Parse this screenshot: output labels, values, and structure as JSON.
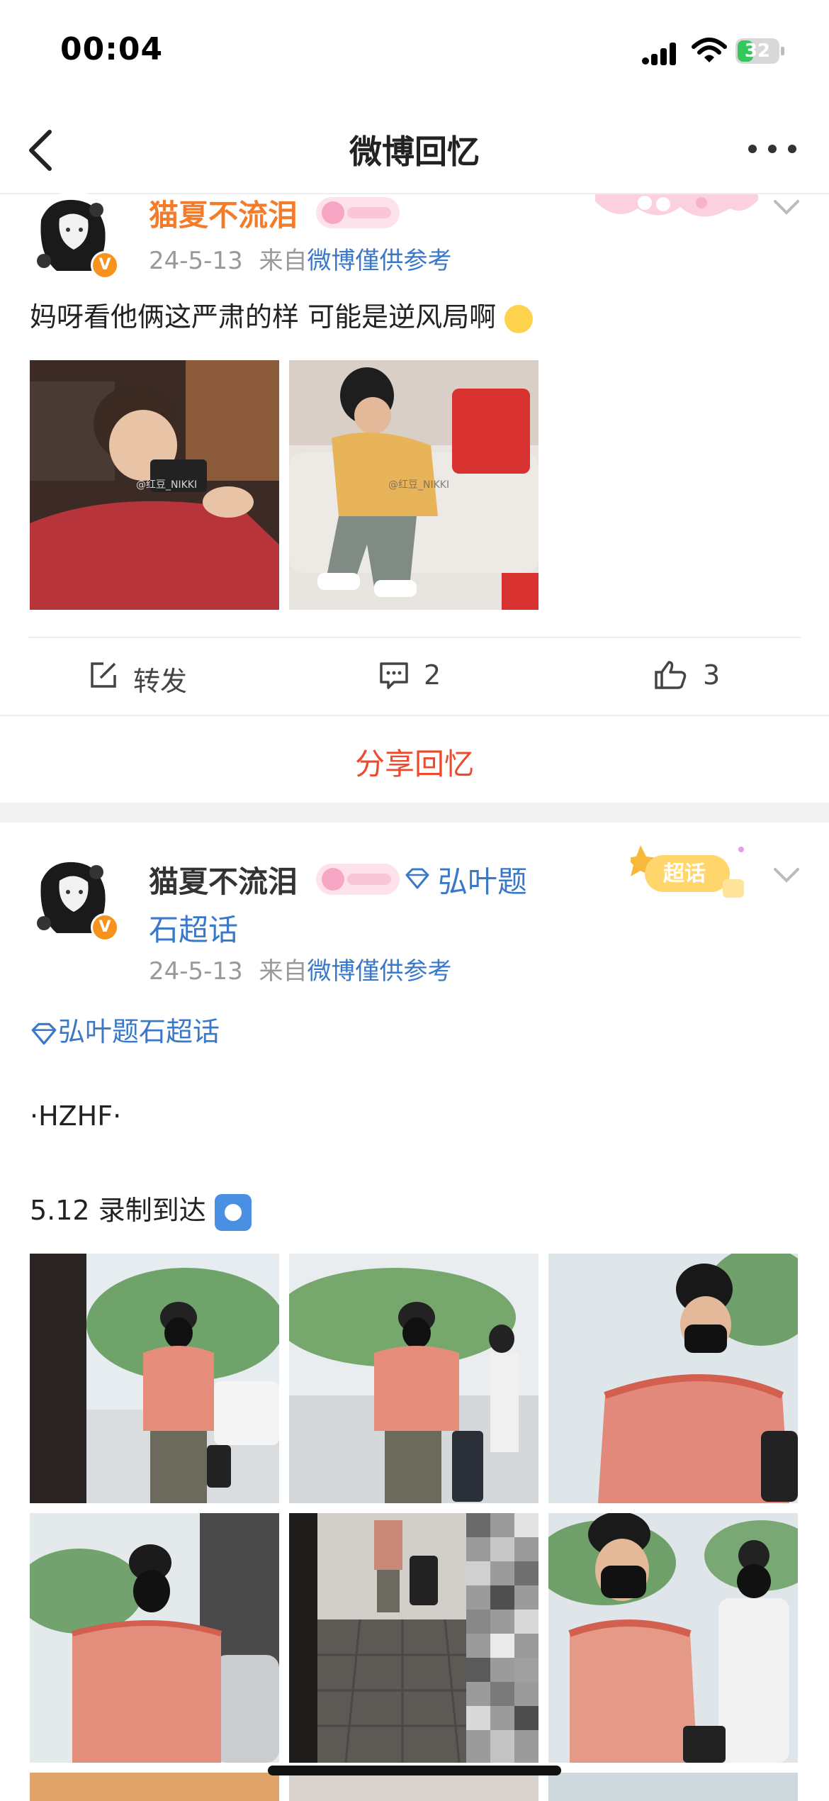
{
  "status": {
    "time": "00:04",
    "battery": "32"
  },
  "nav": {
    "title": "微博回忆"
  },
  "post1": {
    "username": "猫夏不流泪",
    "date": "24-5-13",
    "from_label": "来自",
    "source": "微博僅供参考",
    "text": "妈呀看他俩这严肃的样 可能是逆风局啊",
    "image_watermarks": [
      "@红豆_NIKKI",
      "@红豆_NIKKI"
    ],
    "repost_label": "转发",
    "comment_count": "2",
    "like_count": "3"
  },
  "share_label": "分享回忆",
  "post2": {
    "username": "猫夏不流泪",
    "topic_line1": "弘叶题",
    "topic_line2": "石超话",
    "superbadge": "超话",
    "date": "24-5-13",
    "from_label": "来自",
    "source": "微博僅供参考",
    "topic_link": "弘叶题石超话",
    "line1": "·HZHF·",
    "line2": "5.12 录制到达"
  },
  "colors": {
    "username_orange": "#f47b2a",
    "link_blue": "#3a78c8",
    "share_red": "#ee4a2f",
    "verified_orange": "#f7921e"
  }
}
